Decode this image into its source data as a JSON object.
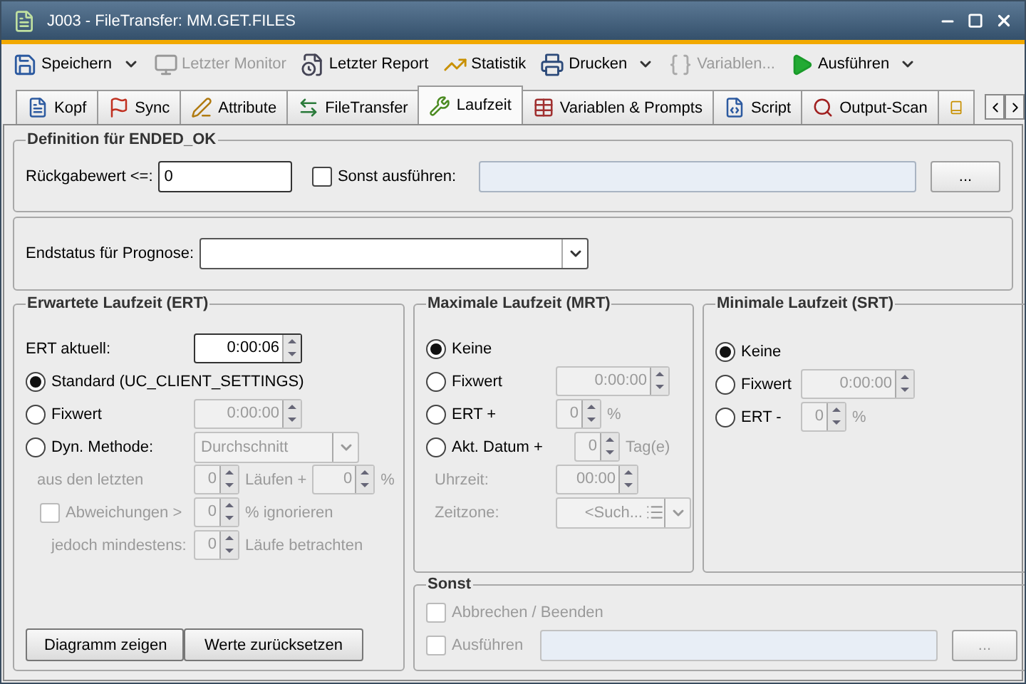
{
  "window": {
    "title": "J003 - FileTransfer: MM.GET.FILES"
  },
  "toolbar": [
    {
      "label": "Speichern",
      "disabled": false,
      "dropdown": true
    },
    {
      "label": "Letzter Monitor",
      "disabled": true,
      "dropdown": false
    },
    {
      "label": "Letzter Report",
      "disabled": false,
      "dropdown": false
    },
    {
      "label": "Statistik",
      "disabled": false,
      "dropdown": false
    },
    {
      "label": "Drucken",
      "disabled": false,
      "dropdown": true
    },
    {
      "label": "Variablen...",
      "disabled": true,
      "dropdown": false
    },
    {
      "label": "Ausführen",
      "disabled": false,
      "dropdown": true
    }
  ],
  "tabs": [
    {
      "label": "Kopf",
      "selected": false
    },
    {
      "label": "Sync",
      "selected": false
    },
    {
      "label": "Attribute",
      "selected": false
    },
    {
      "label": "FileTransfer",
      "selected": false
    },
    {
      "label": "Laufzeit",
      "selected": true
    },
    {
      "label": "Variablen & Prompts",
      "selected": false
    },
    {
      "label": "Script",
      "selected": false
    },
    {
      "label": "Output-Scan",
      "selected": false
    }
  ],
  "ended_ok": {
    "title": "Definition für ENDED_OK",
    "return_label": "Rückgabewert <=:",
    "return_value": "0",
    "else_run": {
      "label": "Sonst ausführen:",
      "checked": false
    },
    "browse": "..."
  },
  "forecast": {
    "label": "Endstatus für Prognose:"
  },
  "ert": {
    "title": "Erwartete Laufzeit (ERT)",
    "current_label": "ERT aktuell:",
    "current_value": "0:00:06",
    "options": [
      {
        "label": "Standard (UC_CLIENT_SETTINGS)",
        "selected": true,
        "kind": "plain"
      },
      {
        "label": "Fixwert",
        "selected": false,
        "kind": "spinner",
        "value": "0:00:00",
        "disabled": true
      },
      {
        "label": "Dyn. Methode:",
        "selected": false,
        "kind": "combo",
        "value": "Durchschnitt",
        "disabled": true
      }
    ],
    "dynamic": {
      "disabled": true,
      "last_label": "aus den letzten",
      "last_value": "0",
      "runs_label": "Läufen +",
      "plus_value": "0",
      "percent": "%",
      "deviation": {
        "label": "Abweichungen >",
        "checked": false,
        "value": "0",
        "suffix": "% ignorieren"
      },
      "minimum": {
        "label": "jedoch mindestens:",
        "value": "0",
        "suffix": "Läufe betrachten"
      }
    },
    "buttons": [
      "Diagramm zeigen",
      "Werte zurücksetzen"
    ]
  },
  "mrt": {
    "title": "Maximale Laufzeit (MRT)",
    "options": [
      {
        "label": "Keine",
        "selected": true,
        "kind": "plain"
      },
      {
        "label": "Fixwert",
        "selected": false,
        "kind": "time",
        "value": "0:00:00"
      },
      {
        "label": "ERT +",
        "selected": false,
        "kind": "number",
        "value": "0",
        "suffix": "%"
      },
      {
        "label": "Akt. Datum +",
        "selected": false,
        "kind": "number",
        "value": "0",
        "suffix": "Tag(e)"
      }
    ],
    "disabled": true,
    "time": {
      "label": "Uhrzeit:",
      "value": "00:00"
    },
    "zone": {
      "label": "Zeitzone:",
      "value": "<Such..."
    }
  },
  "srt": {
    "title": "Minimale Laufzeit (SRT)",
    "options": [
      {
        "label": "Keine",
        "selected": true,
        "kind": "plain"
      },
      {
        "label": "Fixwert",
        "selected": false,
        "kind": "time",
        "value": "0:00:00"
      },
      {
        "label": "ERT -",
        "selected": false,
        "kind": "number",
        "value": "0",
        "suffix": "%"
      }
    ],
    "disabled": true
  },
  "else": {
    "title": "Sonst",
    "disabled": true,
    "options": [
      {
        "label": "Abbrechen / Beenden",
        "checked": false,
        "kind": "checkbox"
      },
      {
        "label": "Ausführen",
        "checked": false,
        "kind": "command"
      }
    ],
    "browse": "..."
  }
}
